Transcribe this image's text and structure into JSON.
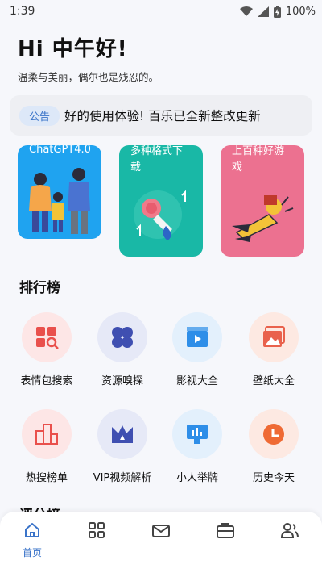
{
  "status": {
    "time": "1:39",
    "battery": "100%"
  },
  "greeting": {
    "title": "Hi 中午好!",
    "subtitle": "温柔与美丽，偶尔也是残忍的。"
  },
  "notice": {
    "badge": "公告",
    "text": "好的使用体验!   百乐已全新整改更新"
  },
  "cards": [
    {
      "text_line1": "ChatGPT4.0",
      "text_line2": ""
    },
    {
      "text_line1": "多种格式下",
      "text_line2": "载"
    },
    {
      "text_line1": "上百种好游",
      "text_line2": "戏"
    }
  ],
  "sections": {
    "ranking": "排行榜",
    "rating_partial": "评分榜"
  },
  "grid": [
    {
      "label": "表情包搜索",
      "icon": "meme-search-icon"
    },
    {
      "label": "资源嗅探",
      "icon": "clover-icon"
    },
    {
      "label": "影视大全",
      "icon": "video-icon"
    },
    {
      "label": "壁纸大全",
      "icon": "image-icon"
    },
    {
      "label": "热搜榜单",
      "icon": "podium-icon"
    },
    {
      "label": "VIP视频解析",
      "icon": "crown-icon"
    },
    {
      "label": "小人举牌",
      "icon": "sign-board-icon"
    },
    {
      "label": "历史今天",
      "icon": "clock-icon"
    }
  ],
  "nav": {
    "home_label": "首页"
  },
  "colors": {
    "accent": "#3b74c9",
    "card_blue": "#1fa3f0",
    "card_teal": "#19b8a6",
    "card_pink": "#ec7190"
  }
}
